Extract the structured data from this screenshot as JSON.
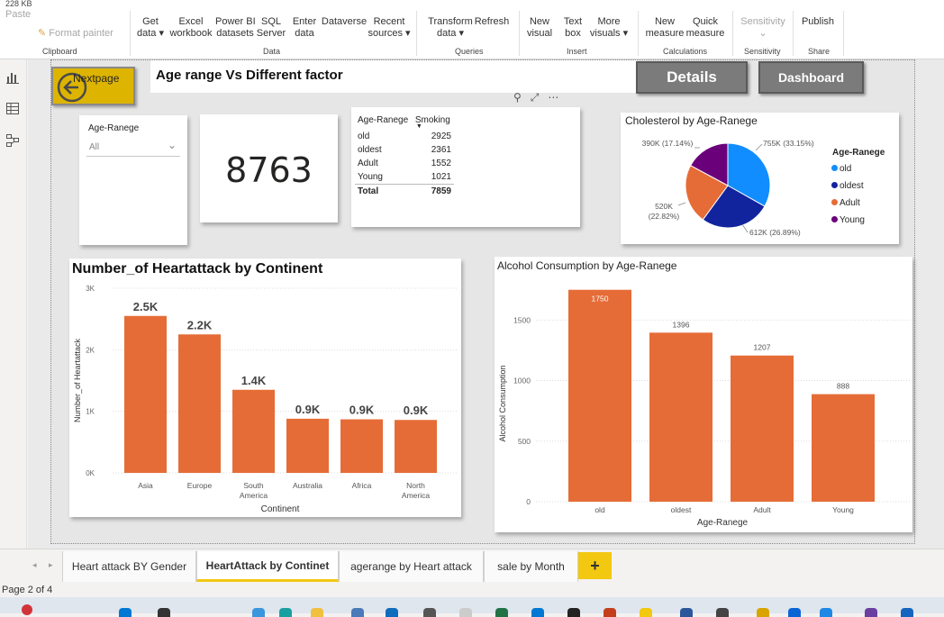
{
  "top": {
    "file_size": "228 KB"
  },
  "ribbon": {
    "paste": "Paste",
    "format_painter": "Format painter",
    "get_data": [
      "Get",
      "data ▾"
    ],
    "excel": [
      "Excel",
      "workbook"
    ],
    "powerbi": [
      "Power BI",
      "datasets"
    ],
    "sql": [
      "SQL",
      "Server"
    ],
    "enter": [
      "Enter",
      "data"
    ],
    "dataverse": [
      "Dataverse",
      ""
    ],
    "recent": [
      "Recent",
      "sources ▾"
    ],
    "transform": [
      "Transform",
      "data ▾"
    ],
    "refresh": [
      "Refresh",
      ""
    ],
    "new_visual": [
      "New",
      "visual"
    ],
    "text_box": [
      "Text",
      "box"
    ],
    "more_visuals": [
      "More",
      "visuals ▾"
    ],
    "new_measure": [
      "New",
      "measure"
    ],
    "quick_measure": [
      "Quick",
      "measure"
    ],
    "sensitivity": [
      "Sensitivity",
      "⌄"
    ],
    "publish": [
      "Publish",
      ""
    ],
    "groups": {
      "clipboard": "Clipboard",
      "data": "Data",
      "queries": "Queries",
      "insert": "Insert",
      "calculations": "Calculations",
      "sensitivity": "Sensitivity",
      "share": "Share"
    }
  },
  "report": {
    "nav_button": "Nextpage",
    "title": "Age range Vs Different factor",
    "details_button": "Details",
    "dashboard_button": "Dashboard",
    "slicer": {
      "title": "Age-Ranege",
      "value": "All"
    },
    "kpi": {
      "value": "8763"
    },
    "table": {
      "headers": [
        "Age-Ranege",
        "Smoking"
      ],
      "rows": [
        [
          "old",
          "2925"
        ],
        [
          "oldest",
          "2361"
        ],
        [
          "Adult",
          "1552"
        ],
        [
          "Young",
          "1021"
        ]
      ],
      "total": [
        "Total",
        "7859"
      ]
    }
  },
  "pages": {
    "tabs": [
      "Heart attack BY Gender",
      "HeartAttack by Continet",
      "agerange by Heart attack",
      "sale by Month"
    ],
    "active": 1,
    "add": "+",
    "status": "Page 2 of 4"
  },
  "chart_data": [
    {
      "type": "pie",
      "title": "Cholesterol by Age-Ranege",
      "legend_title": "Age-Ranege",
      "legend_position": "right",
      "categories": [
        "old",
        "oldest",
        "Adult",
        "Young"
      ],
      "values": [
        755,
        612,
        520,
        390
      ],
      "percent_labels": [
        "755K (33.15%)",
        "612K (26.89%)",
        "520K (22.82%)",
        "390K (17.14%)"
      ],
      "colors": [
        "#118dff",
        "#12239e",
        "#e66c37",
        "#6b007b"
      ]
    },
    {
      "type": "bar",
      "title": "Number_of Heartattack by Continent",
      "xlabel": "Continent",
      "ylabel": "Number_of Heartattack",
      "categories": [
        "Asia",
        "Europe",
        "South America",
        "Australia",
        "Africa",
        "North America"
      ],
      "values": [
        2550,
        2250,
        1350,
        880,
        870,
        860
      ],
      "data_labels": [
        "2.5K",
        "2.2K",
        "1.4K",
        "0.9K",
        "0.9K",
        "0.9K"
      ],
      "yticks": [
        "0K",
        "1K",
        "2K",
        "3K"
      ],
      "ylim": [
        0,
        3000
      ],
      "color": "#e66c37",
      "grid": true
    },
    {
      "type": "bar",
      "title": "Alcohol Consumption by Age-Ranege",
      "xlabel": "Age-Ranege",
      "ylabel": "Alcohol Consumption",
      "categories": [
        "old",
        "oldest",
        "Adult",
        "Young"
      ],
      "values": [
        1750,
        1396,
        1207,
        888
      ],
      "yticks": [
        "0",
        "500",
        "1000",
        "1500"
      ],
      "ylim": [
        0,
        1800
      ],
      "color": "#e66c37",
      "grid": true
    }
  ]
}
